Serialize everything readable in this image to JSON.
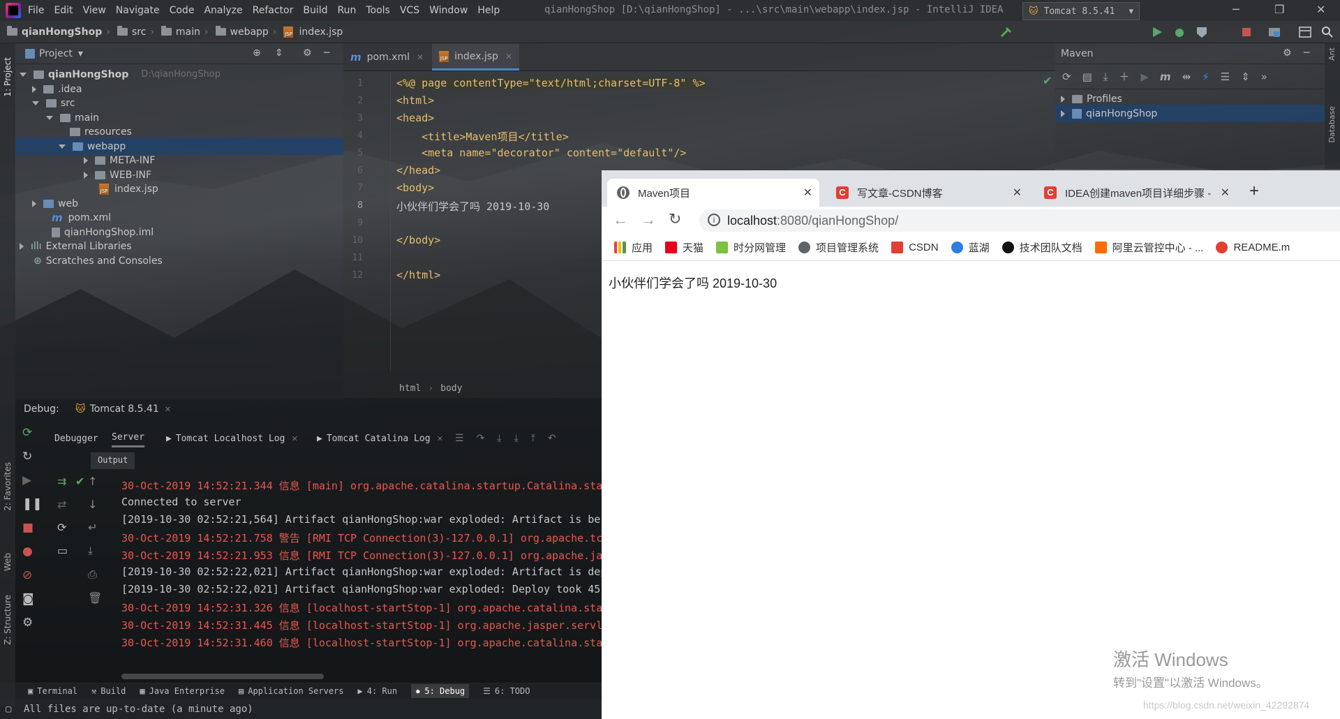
{
  "ide": {
    "title": "qianHongShop [D:\\qianHongShop] - ...\\src\\main\\webapp\\index.jsp - IntelliJ IDEA",
    "menu": [
      "File",
      "Edit",
      "View",
      "Navigate",
      "Code",
      "Analyze",
      "Refactor",
      "Build",
      "Run",
      "Tools",
      "VCS",
      "Window",
      "Help"
    ],
    "breadcrumb": [
      "qianHongShop",
      "src",
      "main",
      "webapp",
      "index.jsp"
    ],
    "run_config": "Tomcat 8.5.41",
    "project_panel": {
      "header": "Project",
      "tree": [
        {
          "label": "qianHongShop",
          "path": "D:\\qianHongShop"
        },
        {
          "label": ".idea"
        },
        {
          "label": "src"
        },
        {
          "label": "main"
        },
        {
          "label": "resources"
        },
        {
          "label": "webapp"
        },
        {
          "label": "META-INF"
        },
        {
          "label": "WEB-INF"
        },
        {
          "label": "index.jsp"
        },
        {
          "label": "web"
        },
        {
          "label": "pom.xml"
        },
        {
          "label": "qianHongShop.iml"
        },
        {
          "label": "External Libraries"
        },
        {
          "label": "Scratches and Consoles"
        }
      ]
    },
    "editor": {
      "tabs": [
        "pom.xml",
        "index.jsp"
      ],
      "line_numbers": [
        "1",
        "2",
        "3",
        "4",
        "5",
        "6",
        "7",
        "8",
        "9",
        "10",
        "11",
        "12"
      ],
      "lines": [
        "<%@ page contentType=\"text/html;charset=UTF-8\" %>",
        "<html>",
        "<head>",
        "    <title>Maven项目</title>",
        "    <meta name=\"decorator\" content=\"default\"/>",
        "</head>",
        "<body>",
        "小伙伴们学会了吗 2019-10-30",
        "",
        "</body>",
        "",
        "</html>"
      ],
      "breadcrumb": [
        "html",
        "body"
      ]
    },
    "maven": {
      "header": "Maven",
      "items": [
        "Profiles",
        "qianHongShop"
      ]
    },
    "right_stripe": [
      "Ant",
      "Database"
    ],
    "left_stripe": [
      "1: Project",
      "2: Favorites",
      "Web",
      "Z: Structure"
    ],
    "debug": {
      "label": "Debug:",
      "session": "Tomcat 8.5.41",
      "tabs": [
        "Debugger",
        "Server",
        "Tomcat Localhost Log",
        "Tomcat Catalina Log"
      ],
      "output_label": "Output",
      "log": [
        {
          "text": "30-Oct-2019 14:52:21.344 信息 [main] org.apache.catalina.startup.Catalina.sta",
          "level": "info"
        },
        {
          "text": "Connected to server",
          "level": "plain"
        },
        {
          "text": "[2019-10-30 02:52:21,564] Artifact qianHongShop:war exploded: Artifact is be",
          "level": "plain"
        },
        {
          "text": "30-Oct-2019 14:52:21.758 警告 [RMI TCP Connection(3)-127.0.0.1] org.apache.tc",
          "level": "info"
        },
        {
          "text": "30-Oct-2019 14:52:21.953 信息 [RMI TCP Connection(3)-127.0.0.1] org.apache.ja",
          "level": "info"
        },
        {
          "text": "[2019-10-30 02:52:22,021] Artifact qianHongShop:war exploded: Artifact is dep",
          "level": "plain"
        },
        {
          "text": "[2019-10-30 02:52:22,021] Artifact qianHongShop:war exploded: Deploy took 45",
          "level": "plain"
        },
        {
          "text": "30-Oct-2019 14:52:31.326 信息 [localhost-startStop-1] org.apache.catalina.sta",
          "level": "info"
        },
        {
          "text": "30-Oct-2019 14:52:31.445 信息 [localhost-startStop-1] org.apache.jasper.servl",
          "level": "info"
        },
        {
          "text": "30-Oct-2019 14:52:31.460 信息 [localhost-startStop-1] org.apache.catalina.sta",
          "level": "info"
        }
      ]
    },
    "bottom_tools": [
      "Terminal",
      "Build",
      "Java Enterprise",
      "Application Servers",
      "4: Run",
      "5: Debug",
      "6: TODO"
    ],
    "status": "All files are up-to-date (a minute ago)"
  },
  "browser": {
    "tabs": [
      {
        "title": "Maven项目",
        "active": true
      },
      {
        "title": "写文章-CSDN博客",
        "active": false
      },
      {
        "title": "IDEA创建maven项目详细步骤 -",
        "active": false
      }
    ],
    "url_host": "localhost",
    "url_rest": ":8080/qianHongShop/",
    "bookmarks": [
      "应用",
      "天猫",
      "时分网管理",
      "项目管理系统",
      "CSDN",
      "蓝湖",
      "技术团队文档",
      "阿里云管控中心 - ...",
      "README.m"
    ],
    "page_text": "小伙伴们学会了吗 2019-10-30"
  },
  "windows_activation": {
    "line1": "激活 Windows",
    "line2": "转到\"设置\"以激活 Windows。"
  },
  "watermark": "https://blog.csdn.net/weixin_42292874"
}
